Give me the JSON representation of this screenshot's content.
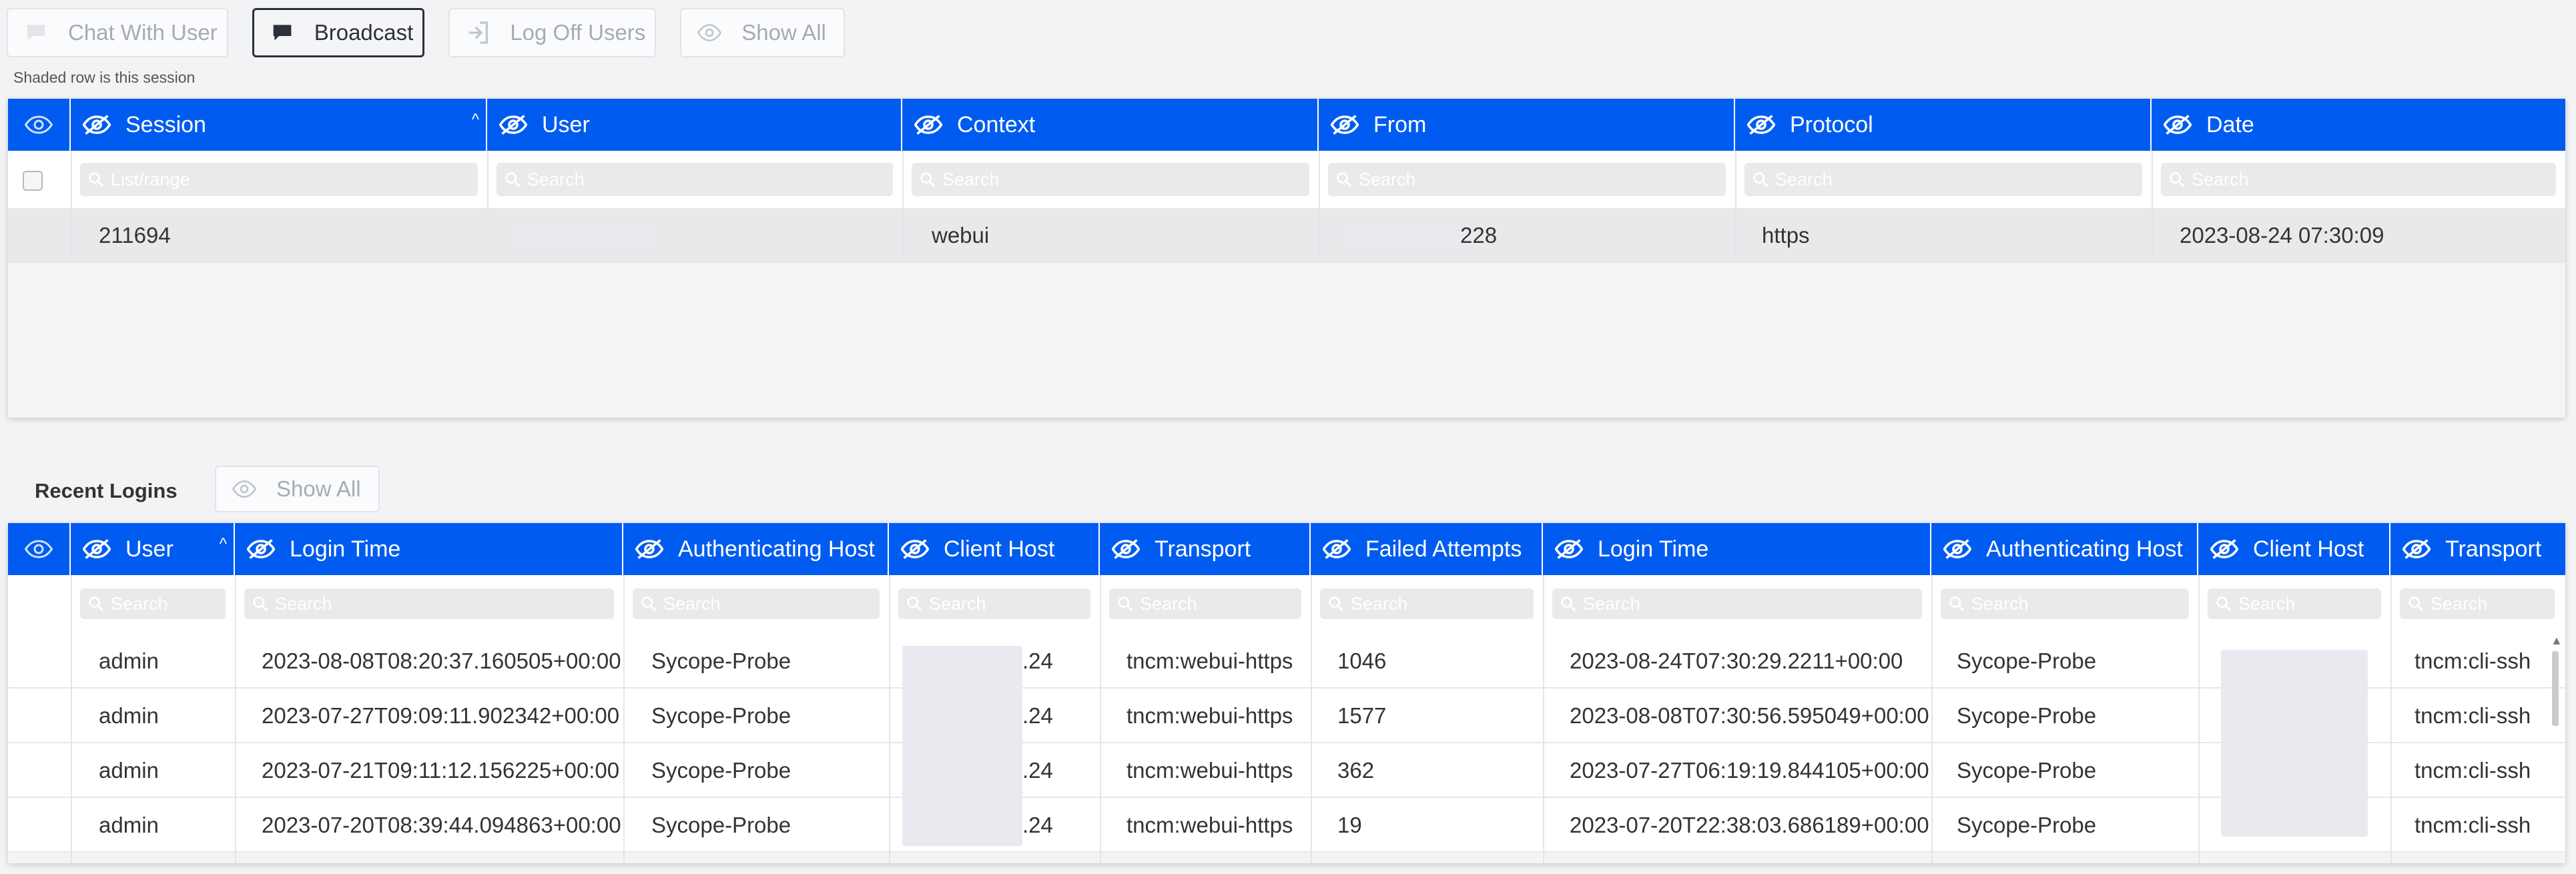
{
  "toolbar": {
    "chat_label": "Chat With User",
    "broadcast_label": "Broadcast",
    "logoff_label": "Log Off Users",
    "showall_label": "Show All"
  },
  "note": "Shaded row is this session",
  "sessions": {
    "columns": [
      "Session",
      "User",
      "Context",
      "From",
      "Protocol",
      "Date"
    ],
    "filters": [
      "List/range",
      "Search",
      "Search",
      "Search",
      "Search",
      "Search"
    ],
    "rows": [
      {
        "session": "211694",
        "user": "",
        "context": "webui",
        "from": "228",
        "protocol": "https",
        "date": "2023-08-24 07:30:09"
      }
    ]
  },
  "recent": {
    "title": "Recent Logins",
    "showall_label": "Show All",
    "columns": [
      "User",
      "Login Time",
      "Authenticating Host",
      "Client Host",
      "Transport",
      "Failed Attempts",
      "Login Time",
      "Authenticating Host",
      "Client Host",
      "Transport"
    ],
    "filter_placeholder": "Search",
    "rows": [
      {
        "user": "admin",
        "login1": "2023-08-08T08:20:37.160505+00:00",
        "auth1": "Sycope-Probe",
        "client1": ".24",
        "transport1": "tncm:webui-https",
        "failed": "1046",
        "login2": "2023-08-24T07:30:29.2211+00:00",
        "auth2": "Sycope-Probe",
        "client2": "",
        "transport2": "tncm:cli-ssh"
      },
      {
        "user": "admin",
        "login1": "2023-07-27T09:09:11.902342+00:00",
        "auth1": "Sycope-Probe",
        "client1": ".24",
        "transport1": "tncm:webui-https",
        "failed": "1577",
        "login2": "2023-08-08T07:30:56.595049+00:00",
        "auth2": "Sycope-Probe",
        "client2": "",
        "transport2": "tncm:cli-ssh"
      },
      {
        "user": "admin",
        "login1": "2023-07-21T09:11:12.156225+00:00",
        "auth1": "Sycope-Probe",
        "client1": ".24",
        "transport1": "tncm:webui-https",
        "failed": "362",
        "login2": "2023-07-27T06:19:19.844105+00:00",
        "auth2": "Sycope-Probe",
        "client2": "",
        "transport2": "tncm:cli-ssh"
      },
      {
        "user": "admin",
        "login1": "2023-07-20T08:39:44.094863+00:00",
        "auth1": "Sycope-Probe",
        "client1": ".24",
        "transport1": "tncm:webui-https",
        "failed": "19",
        "login2": "2023-07-20T22:38:03.686189+00:00",
        "auth2": "Sycope-Probe",
        "client2": "",
        "transport2": "tncm:cli-ssh"
      }
    ]
  }
}
